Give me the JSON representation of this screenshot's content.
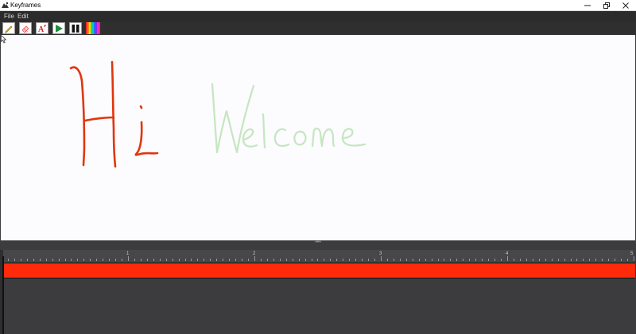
{
  "window": {
    "title": "Keyframes",
    "controls": [
      "minimize-icon",
      "restore-icon",
      "close-icon"
    ]
  },
  "menu": {
    "file": "File",
    "edit": "Edit"
  },
  "toolbar": {
    "tools": [
      "pencil-icon",
      "eraser-icon",
      "text-icon",
      "play-icon",
      "pause-icon",
      "color-picker-icon"
    ],
    "text_tool_label": "A"
  },
  "canvas": {
    "strokes": [
      {
        "content": "Hi",
        "color": "#e0360c"
      },
      {
        "content": "Welcome",
        "color": "#c5e6c0"
      }
    ]
  },
  "timeline": {
    "markers": [
      "1",
      "2",
      "3",
      "4",
      "5"
    ],
    "track_color": "#ff2a0a"
  },
  "colors": {
    "menubar": "#2b2b2b",
    "canvas": "#fcfbfe",
    "panel": "#3c3c3e"
  }
}
